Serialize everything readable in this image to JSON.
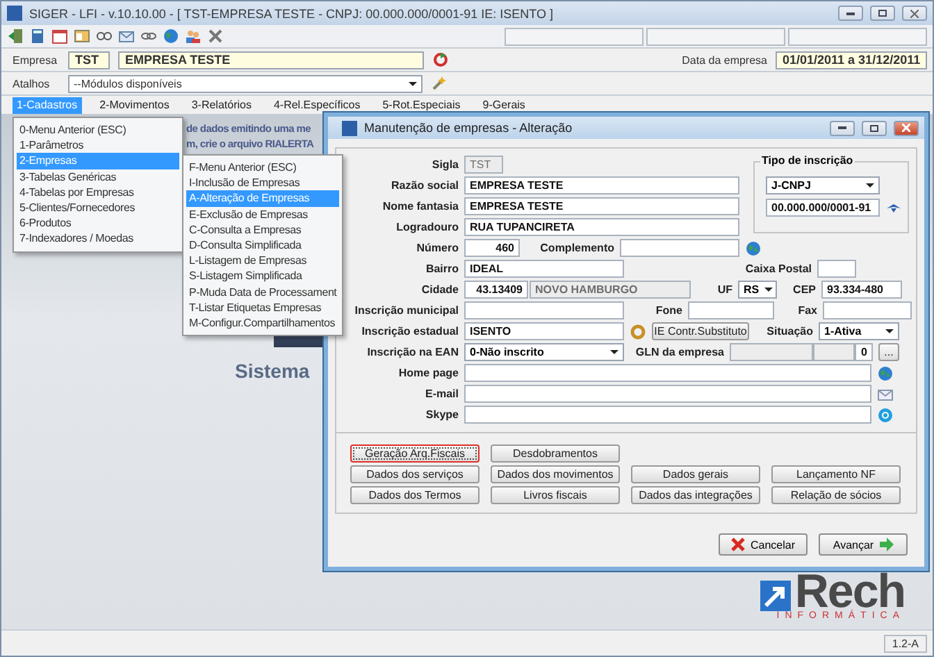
{
  "window": {
    "title": "SIGER - LFI - v.10.10.00 - [ TST-EMPRESA TESTE - CNPJ: 00.000.000/0001-91 IE: ISENTO ]"
  },
  "empresa": {
    "label": "Empresa",
    "code": "TST",
    "name": "EMPRESA TESTE",
    "date_label": "Data da empresa",
    "date_value": "01/01/2011 a 31/12/2011"
  },
  "atalhos": {
    "label": "Atalhos",
    "value": "--Módulos disponíveis"
  },
  "menu_bar": [
    {
      "label": "1-Cadastros",
      "selected": true
    },
    {
      "label": "2-Movimentos",
      "selected": false
    },
    {
      "label": "3-Relatórios",
      "selected": false
    },
    {
      "label": "4-Rel.Específicos",
      "selected": false
    },
    {
      "label": "5-Rot.Especiais",
      "selected": false
    },
    {
      "label": "9-Gerais",
      "selected": false
    }
  ],
  "dropdown": [
    {
      "label": "0-Menu Anterior (ESC)",
      "selected": false
    },
    {
      "label": "1-Parâmetros",
      "selected": false
    },
    {
      "label": "2-Empresas",
      "selected": true
    },
    {
      "label": "3-Tabelas Genéricas",
      "selected": false
    },
    {
      "label": "4-Tabelas por Empresas",
      "selected": false
    },
    {
      "label": "5-Clientes/Fornecedores",
      "selected": false
    },
    {
      "label": "6-Produtos",
      "selected": false
    },
    {
      "label": "7-Indexadores / Moedas",
      "selected": false
    }
  ],
  "submenu": [
    {
      "label": "F-Menu Anterior (ESC)",
      "selected": false
    },
    {
      "label": "I-Inclusão de Empresas",
      "selected": false
    },
    {
      "label": "A-Alteração de Empresas",
      "selected": true
    },
    {
      "label": "E-Exclusão de Empresas",
      "selected": false
    },
    {
      "label": "C-Consulta a Empresas",
      "selected": false
    },
    {
      "label": "D-Consulta Simplificada",
      "selected": false
    },
    {
      "label": "L-Listagem de Empresas",
      "selected": false
    },
    {
      "label": "S-Listagem Simplificada",
      "selected": false
    },
    {
      "label": "P-Muda Data de Processament",
      "selected": false
    },
    {
      "label": "T-Listar Etiquetas Empresas",
      "selected": false
    },
    {
      "label": "M-Configur.Compartilhamentos",
      "selected": false
    }
  ],
  "background_text": [
    "de dados emitindo uma me",
    "m, crie o arquivo RIALERTA"
  ],
  "background_title": "Sistema",
  "logo": {
    "name": "Rech",
    "tagline": "INFORMÁTICA"
  },
  "status_bar": {
    "version": "1.2-A"
  },
  "dialog": {
    "title": "Manutenção de empresas - Alteração",
    "sigla": {
      "label": "Sigla",
      "value": "TST",
      "disabled": true
    },
    "razao_social": {
      "label": "Razão social",
      "value": "EMPRESA TESTE"
    },
    "nome_fantasia": {
      "label": "Nome fantasia",
      "value": "EMPRESA TESTE"
    },
    "logradouro": {
      "label": "Logradouro",
      "value": "RUA TUPANCIRETA"
    },
    "numero": {
      "label": "Número",
      "value": "460"
    },
    "complemento": {
      "label": "Complemento"
    },
    "bairro": {
      "label": "Bairro",
      "value": "IDEAL"
    },
    "caixa_postal": {
      "label": "Caixa Postal"
    },
    "cidade": {
      "label": "Cidade",
      "code": "43.13409",
      "name": "NOVO HAMBURGO"
    },
    "uf": {
      "label": "UF",
      "value": "RS"
    },
    "cep": {
      "label": "CEP",
      "value": "93.334-480"
    },
    "inscricao_municipal": {
      "label": "Inscrição municipal"
    },
    "fone": {
      "label": "Fone"
    },
    "fax": {
      "label": "Fax"
    },
    "inscricao_estadual": {
      "label": "Inscrição estadual",
      "value": "ISENTO"
    },
    "ie_button": "IE Contr.Substituto",
    "situacao": {
      "label": "Situação",
      "value": "1-Ativa"
    },
    "inscricao_ean": {
      "label": "Inscrição na EAN",
      "value": "0-Não inscrito"
    },
    "gln": {
      "label": "GLN da empresa",
      "check_digit": "0",
      "button": "..."
    },
    "home_page": {
      "label": "Home page"
    },
    "email": {
      "label": "E-mail"
    },
    "skype": {
      "label": "Skype"
    },
    "tipo_inscricao": {
      "title": "Tipo de inscrição",
      "value": "J-CNPJ",
      "document": "00.000.000/0001-91"
    },
    "action_rows": [
      {
        "buttons": [
          {
            "label": "Geração Arq.Fiscais",
            "focused": true
          },
          {
            "label": "Desdobramentos",
            "focused": false
          }
        ]
      },
      {
        "buttons": [
          {
            "label": "Dados dos serviços",
            "focused": false
          },
          {
            "label": "Dados dos movimentos",
            "focused": false
          },
          {
            "label": "Dados gerais",
            "focused": false
          },
          {
            "label": "Lançamento NF",
            "focused": false
          }
        ]
      },
      {
        "buttons": [
          {
            "label": "Dados dos Termos",
            "focused": false
          },
          {
            "label": "Livros fiscais",
            "focused": false
          },
          {
            "label": "Dados das integrações",
            "focused": false
          },
          {
            "label": "Relação de sócios",
            "focused": false
          }
        ]
      }
    ],
    "footer_buttons": [
      {
        "label": "Cancelar",
        "kind": "cancel"
      },
      {
        "label": "Avançar",
        "kind": "next"
      }
    ]
  }
}
